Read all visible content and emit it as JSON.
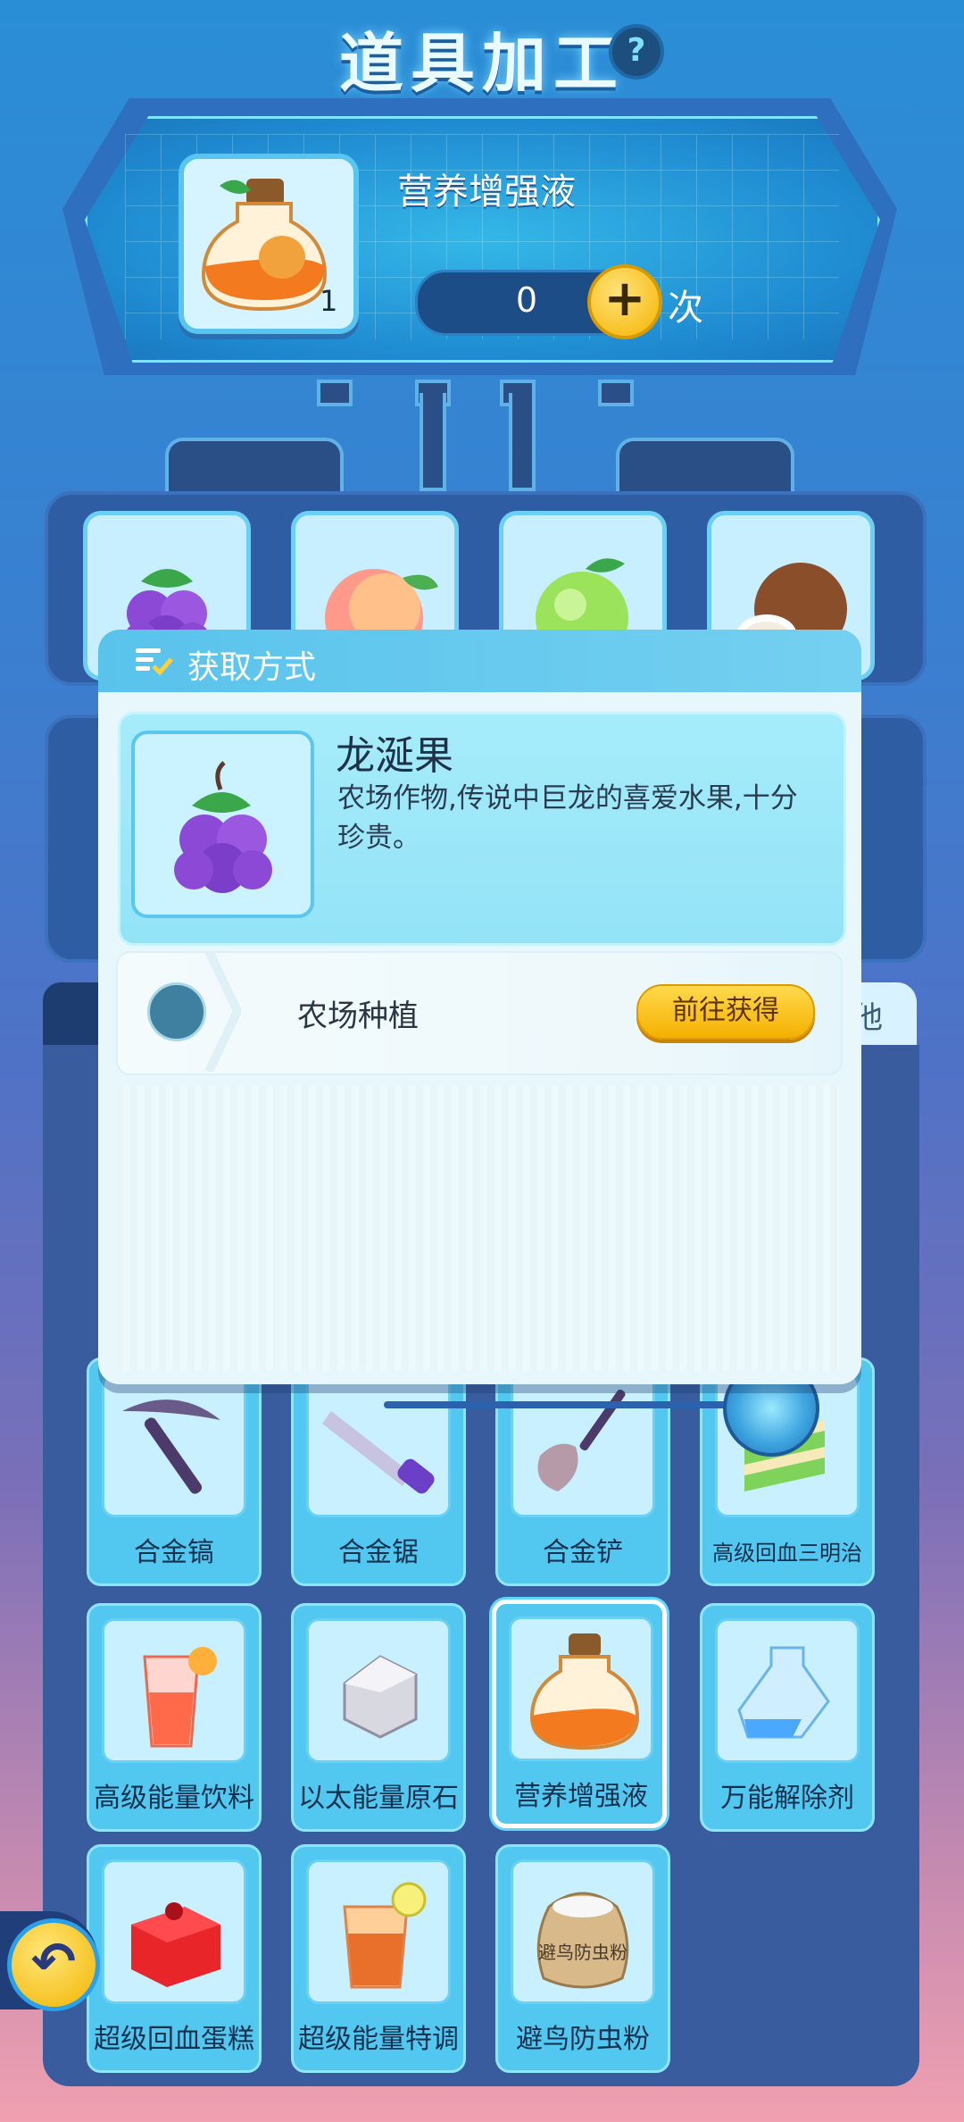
{
  "header": {
    "title": "道具加工",
    "help_icon": "?"
  },
  "product": {
    "name": "营养增强液",
    "owned_count": "1",
    "quantity": "0",
    "plus": "+",
    "unit": "次"
  },
  "ingredients": [
    "grape-dragon-icon",
    "peach-icon",
    "green-apple-icon",
    "coconut-icon"
  ],
  "tabs": {
    "right_label": "他"
  },
  "popup": {
    "title": "获取方式",
    "item_name": "龙涎果",
    "item_desc": "农场作物,传说中巨龙的喜爱水果,十分珍贵。",
    "source": {
      "label": "农场种植",
      "button": "前往获得"
    }
  },
  "items": [
    {
      "label": "合金镐",
      "icon": "pickaxe-icon"
    },
    {
      "label": "合金锯",
      "icon": "saw-icon"
    },
    {
      "label": "合金铲",
      "icon": "shovel-icon"
    },
    {
      "label": "高级回血三明治",
      "icon": "sandwich-icon"
    },
    {
      "label": "高级能量饮料",
      "icon": "energy-drink-icon"
    },
    {
      "label": "以太能量原石",
      "icon": "ether-stone-icon"
    },
    {
      "label": "营养增强液",
      "icon": "nutrient-potion-icon"
    },
    {
      "label": "万能解除剂",
      "icon": "antidote-bottle-icon"
    },
    {
      "label": "超级回血蛋糕",
      "icon": "cake-icon"
    },
    {
      "label": "超级能量特调",
      "icon": "iced-tea-icon"
    },
    {
      "label": "避鸟防虫粉",
      "icon": "powder-sack-icon"
    }
  ],
  "sack_text": "避鸟防虫粉",
  "colors": {
    "accent": "#f5b400",
    "panel": "#1f8ad1",
    "item_bg": "#52c8f0"
  }
}
